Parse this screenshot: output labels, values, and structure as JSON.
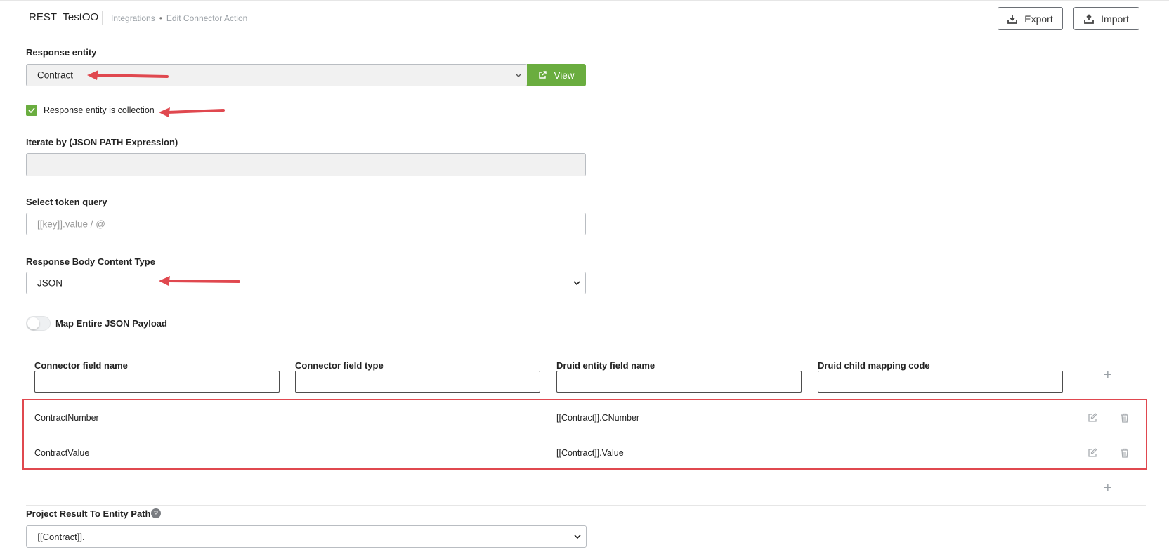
{
  "header": {
    "app_title": "REST_TestOO",
    "breadcrumb": {
      "section": "Integrations",
      "separator": "•",
      "page": "Edit Connector Action"
    },
    "export_label": "Export",
    "import_label": "Import"
  },
  "response_entity": {
    "label": "Response entity",
    "value": "Contract",
    "view_button": "View"
  },
  "is_collection": {
    "label": "Response entity is collection",
    "checked": true
  },
  "iterate_by": {
    "label": "Iterate by (JSON PATH Expression)",
    "value": ""
  },
  "select_token": {
    "label": "Select token query",
    "placeholder": "[[key]].value / @"
  },
  "content_type": {
    "label": "Response Body Content Type",
    "value": "JSON"
  },
  "map_payload": {
    "label": "Map Entire JSON Payload",
    "enabled": false
  },
  "mapping": {
    "columns": [
      "Connector field name",
      "Connector field type",
      "Druid entity field name",
      "Druid child mapping code"
    ],
    "rows": [
      {
        "connector_field": "ContractNumber",
        "field_type": "",
        "druid_field": "[[Contract]].CNumber",
        "child_code": ""
      },
      {
        "connector_field": "ContractValue",
        "field_type": "",
        "druid_field": "[[Contract]].Value",
        "child_code": ""
      }
    ]
  },
  "project_result": {
    "label": "Project Result To Entity Path",
    "prefix": "[[Contract]].",
    "value": ""
  },
  "colors": {
    "accent_green": "#6aad3f",
    "annotation_red": "#e0484f"
  }
}
